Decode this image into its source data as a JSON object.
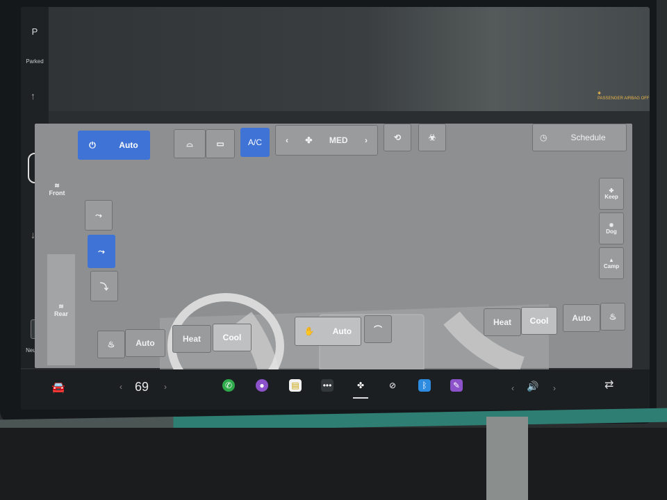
{
  "gear": {
    "park": "P",
    "park_status": "Parked",
    "neutral": "N",
    "neutral_label": "Neutral"
  },
  "header": {
    "airbag_text": "PASSENGER AIRBAG OFF"
  },
  "climate": {
    "auto_label": "Auto",
    "ac_label": "A/C",
    "fan_speed": "MED",
    "schedule_label": "Schedule",
    "front_label": "Front",
    "rear_label": "Rear",
    "right_modes": [
      {
        "label": "Keep",
        "icon": "fan-icon"
      },
      {
        "label": "Dog",
        "icon": "paw-icon"
      },
      {
        "label": "Camp",
        "icon": "tent-icon"
      }
    ],
    "left_seat": {
      "auto": "Auto",
      "heat": "Heat",
      "cool": "Cool"
    },
    "steering": {
      "auto": "Auto"
    },
    "right_seat": {
      "heat": "Heat",
      "cool": "Cool",
      "auto": "Auto"
    }
  },
  "dock": {
    "temperature": "69",
    "apps": [
      "phone-icon",
      "camera-icon",
      "notes-icon",
      "more-icon",
      "fan-icon",
      "no-signal-icon",
      "bluetooth-icon",
      "pen-icon"
    ]
  },
  "colors": {
    "accent": "#3f74d6",
    "panel": "#8e8f90",
    "trim_green": "#2e7e74"
  }
}
